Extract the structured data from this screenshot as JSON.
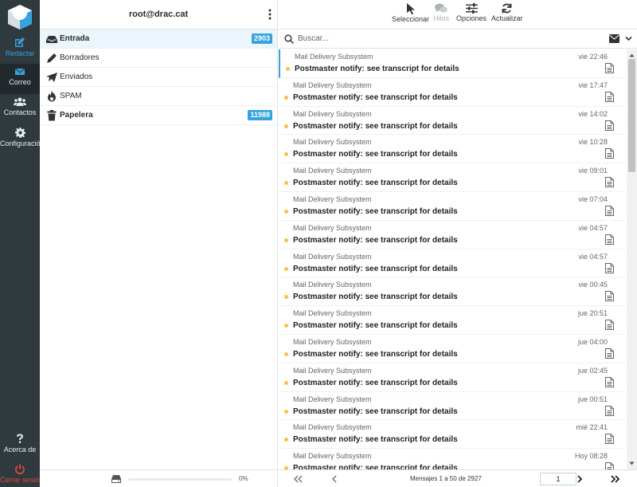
{
  "rail": {
    "compose_label": "Redactar",
    "mail_label": "Correo",
    "contacts_label": "Contactos",
    "settings_label": "Configuración",
    "about_label": "Acerca de",
    "logout_label": "Cerrar sesión"
  },
  "folders": {
    "account": "root@drac.cat",
    "items": [
      {
        "label": "Entrada",
        "count": "2903",
        "icon": "inbox-icon"
      },
      {
        "label": "Borradores",
        "count": "",
        "icon": "pencil-icon"
      },
      {
        "label": "Enviados",
        "count": "",
        "icon": "paper-plane-icon"
      },
      {
        "label": "SPAM",
        "count": "",
        "icon": "fire-icon"
      },
      {
        "label": "Papelera",
        "count": "11988",
        "icon": "trash-icon"
      }
    ],
    "quota": {
      "text": "0%",
      "fraction": 0
    }
  },
  "toolbar": {
    "select_label": "Seleccionar",
    "threads_label": "Hilos",
    "options_label": "Opciones",
    "refresh_label": "Actualizar"
  },
  "search": {
    "placeholder": "Buscar..."
  },
  "messages": [
    {
      "from": "Mail Delivery Subsystem",
      "date": "vie 22:46",
      "subject": "Postmaster notify: see transcript for details"
    },
    {
      "from": "Mail Delivery Subsystem",
      "date": "vie 17:47",
      "subject": "Postmaster notify: see transcript for details"
    },
    {
      "from": "Mail Delivery Subsystem",
      "date": "vie 14:02",
      "subject": "Postmaster notify: see transcript for details"
    },
    {
      "from": "Mail Delivery Subsystem",
      "date": "vie 10:28",
      "subject": "Postmaster notify: see transcript for details"
    },
    {
      "from": "Mail Delivery Subsystem",
      "date": "vie 09:01",
      "subject": "Postmaster notify: see transcript for details"
    },
    {
      "from": "Mail Delivery Subsystem",
      "date": "vie 07:04",
      "subject": "Postmaster notify: see transcript for details"
    },
    {
      "from": "Mail Delivery Subsystem",
      "date": "vie 04:57",
      "subject": "Postmaster notify: see transcript for details"
    },
    {
      "from": "Mail Delivery Subsystem",
      "date": "vie 04:57",
      "subject": "Postmaster notify: see transcript for details"
    },
    {
      "from": "Mail Delivery Subsystem",
      "date": "vie 00:45",
      "subject": "Postmaster notify: see transcript for details"
    },
    {
      "from": "Mail Delivery Subsystem",
      "date": "jue 20:51",
      "subject": "Postmaster notify: see transcript for details"
    },
    {
      "from": "Mail Delivery Subsystem",
      "date": "jue 04:00",
      "subject": "Postmaster notify: see transcript for details"
    },
    {
      "from": "Mail Delivery Subsystem",
      "date": "jue 02:45",
      "subject": "Postmaster notify: see transcript for details"
    },
    {
      "from": "Mail Delivery Subsystem",
      "date": "jue 00:51",
      "subject": "Postmaster notify: see transcript for details"
    },
    {
      "from": "Mail Delivery Subsystem",
      "date": "mié 22:41",
      "subject": "Postmaster notify: see transcript for details"
    },
    {
      "from": "Mail Delivery Subsystem",
      "date": "Hoy 08:28",
      "subject": "Postmaster notify: see transcript for details"
    }
  ],
  "pagination": {
    "info": "Mensajes 1 a 50 de 2927",
    "page": "1"
  },
  "colors": {
    "accent": "#37a3dc",
    "rail": "#2f3a3f",
    "unread_dot": "#f6c343",
    "logout": "#e2483a"
  }
}
